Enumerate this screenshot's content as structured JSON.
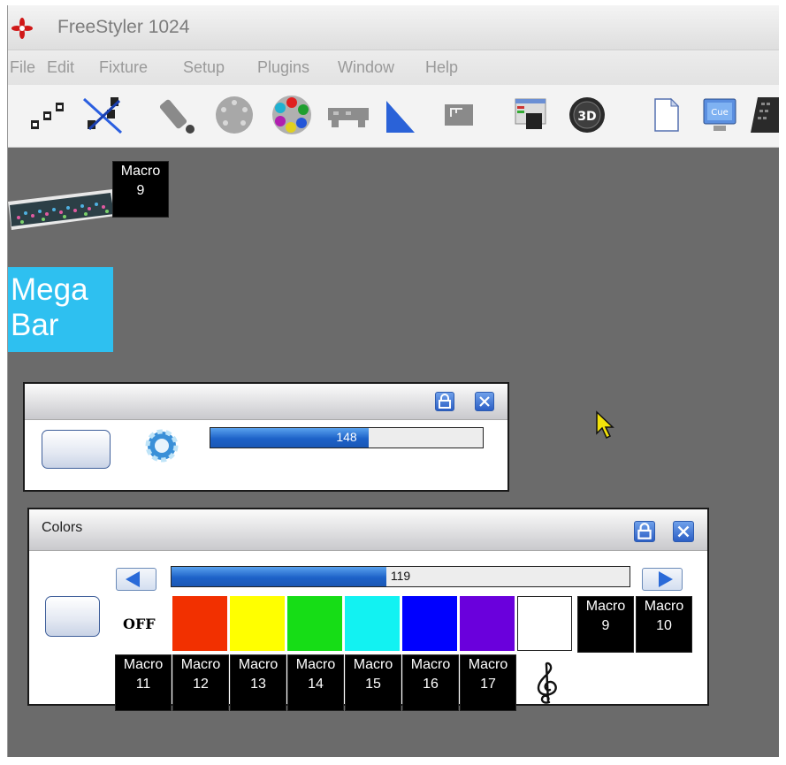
{
  "app": {
    "title": "FreeStyler 1024"
  },
  "menu": [
    "File",
    "Edit",
    "Fixture",
    "Setup",
    "Plugins",
    "Window",
    "Help"
  ],
  "toolbar": {
    "icons": [
      "connect-fixtures-icon",
      "disconnect-fixtures-icon",
      "scanner-icon",
      "gobo-wheel-icon",
      "color-wheel-icon",
      "bar-fixture-icon",
      "slope-icon",
      "dmx-panel-icon",
      "cue-editor-icon",
      "3d-view-icon",
      "new-document-icon",
      "cue-monitor-icon",
      "keyboard-icon"
    ]
  },
  "fixture": {
    "macro_label": "Macro",
    "macro_number": "9",
    "name_line1": "Mega",
    "name_line2": "Bar"
  },
  "panel1": {
    "progress_value": "148",
    "progress_fraction": 0.58
  },
  "colors_panel": {
    "title": "Colors",
    "progress_value": "119",
    "progress_fraction": 0.47,
    "off_label": "OFF",
    "swatches": [
      "#f23000",
      "#ffff00",
      "#16dd16",
      "#12f2f2",
      "#0000ff",
      "#6a00dc",
      "#ffffff"
    ],
    "macro_top": [
      {
        "label": "Macro",
        "num": "9"
      },
      {
        "label": "Macro",
        "num": "10"
      }
    ],
    "macro_bottom": [
      {
        "label": "Macro",
        "num": "11"
      },
      {
        "label": "Macro",
        "num": "12"
      },
      {
        "label": "Macro",
        "num": "13"
      },
      {
        "label": "Macro",
        "num": "14"
      },
      {
        "label": "Macro",
        "num": "15"
      },
      {
        "label": "Macro",
        "num": "16"
      },
      {
        "label": "Macro",
        "num": "17"
      }
    ]
  },
  "colors": {
    "background": "#6b6b6b",
    "megabar": "#2ec0f0",
    "accent": "#1d62c8"
  }
}
